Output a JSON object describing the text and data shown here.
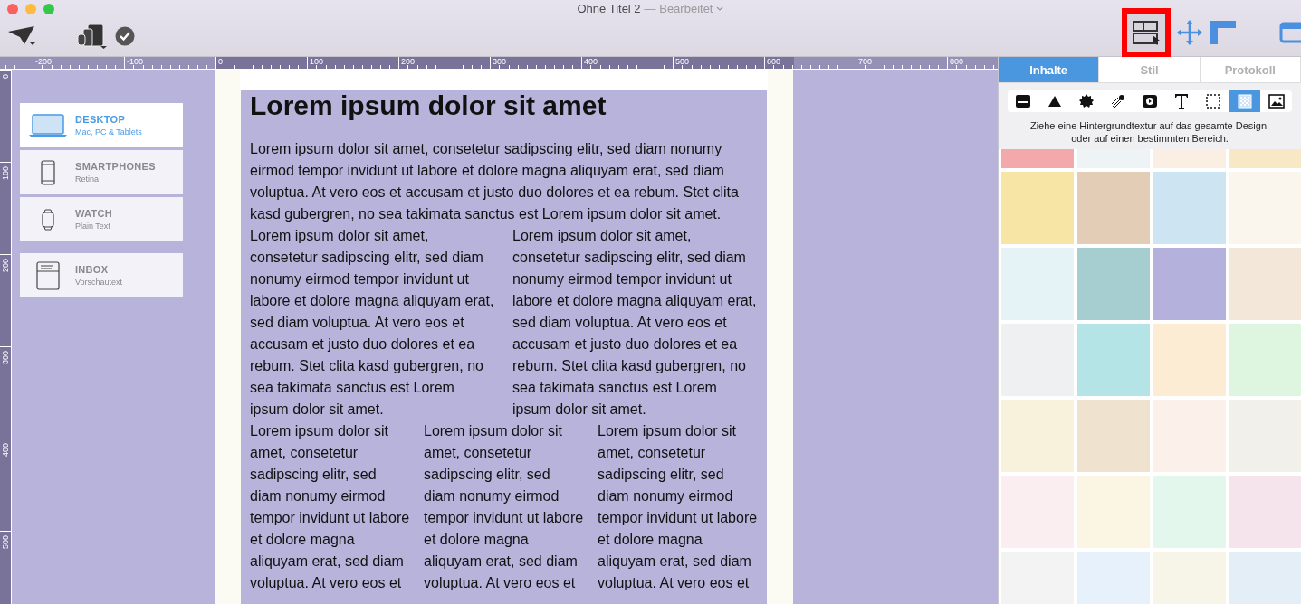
{
  "window": {
    "title": "Ohne Titel 2",
    "status": "— Bearbeitet"
  },
  "ruler": {
    "horizontal": [
      "-200",
      "-100",
      "0",
      "100",
      "200",
      "300",
      "400",
      "500",
      "600",
      "700",
      "800"
    ],
    "vertical": [
      "0",
      "100",
      "200",
      "300",
      "400",
      "500"
    ]
  },
  "devices": [
    {
      "kind": "desktop",
      "name": "DESKTOP",
      "sub": "Mac, PC & Tablets",
      "selected": true
    },
    {
      "kind": "phone",
      "name": "SMARTPHONES",
      "sub": "Retina",
      "selected": false
    },
    {
      "kind": "watch",
      "name": "WATCH",
      "sub": "Plain Text",
      "selected": false
    },
    {
      "kind": "inbox",
      "name": "INBOX",
      "sub": "Vorschautext",
      "selected": false
    }
  ],
  "document": {
    "title": "Lorem ipsum dolor sit amet",
    "intro": "Lorem ipsum dolor sit amet, consetetur sadipscing elitr, sed diam nonumy eirmod tempor invidunt ut labore et dolore magna aliquyam erat, sed diam voluptua. At vero eos et accusam et justo duo dolores et ea rebum. Stet clita kasd gubergren, no sea takimata sanctus est Lorem ipsum dolor sit amet.",
    "two_columns": [
      "Lorem ipsum dolor sit amet, consetetur sadipscing elitr, sed diam nonumy eirmod tempor invidunt ut labore et dolore magna aliquyam erat, sed diam voluptua. At vero eos et accusam et justo duo dolores et ea rebum. Stet clita kasd gubergren, no sea takimata sanctus est Lorem ipsum dolor sit amet.",
      "Lorem ipsum dolor sit amet, consetetur sadipscing elitr, sed diam nonumy eirmod tempor invidunt ut labore et dolore magna aliquyam erat, sed diam voluptua. At vero eos et accusam et justo duo dolores et ea rebum. Stet clita kasd gubergren, no sea takimata sanctus est Lorem ipsum dolor sit amet."
    ],
    "three_columns": [
      "Lorem ipsum dolor sit amet, consetetur sadipscing elitr, sed diam nonumy eirmod tempor invidunt ut labore et dolore magna aliquyam erat, sed diam voluptua. At vero eos et",
      "Lorem ipsum dolor sit amet, consetetur sadipscing elitr, sed diam nonumy eirmod tempor invidunt ut labore et dolore magna aliquyam erat, sed diam voluptua. At vero eos et",
      "Lorem ipsum dolor sit amet, consetetur sadipscing elitr, sed diam nonumy eirmod tempor invidunt ut labore et dolore magna aliquyam erat, sed diam voluptua. At vero eos et"
    ]
  },
  "panel": {
    "tabs": [
      {
        "label": "Inhalte",
        "selected": true
      },
      {
        "label": "Stil",
        "selected": false
      },
      {
        "label": "Protokoll",
        "selected": false
      }
    ],
    "tools": [
      {
        "kind": "block",
        "selected": false
      },
      {
        "kind": "triangle",
        "selected": false
      },
      {
        "kind": "star",
        "selected": false
      },
      {
        "kind": "comet",
        "selected": false
      },
      {
        "kind": "video",
        "selected": false
      },
      {
        "kind": "text",
        "selected": false
      },
      {
        "kind": "frame",
        "selected": false
      },
      {
        "kind": "texture",
        "selected": true
      },
      {
        "kind": "image",
        "selected": false
      }
    ],
    "hint": "Ziehe eine Hintergrundtextur auf das gesamte Design, oder auf einen bestimmten Bereich.",
    "textures": [
      {
        "color": "#f3a9ab"
      },
      {
        "color": "#eef3f5"
      },
      {
        "color": "#fbeee3"
      },
      {
        "color": "#f8e8c6"
      },
      {
        "color": "#f7e5a6"
      },
      {
        "color": "#e4cdb6"
      },
      {
        "color": "#cde5f3"
      },
      {
        "color": "#faf6ee"
      },
      {
        "color": "#e6f3f6"
      },
      {
        "color": "#a6cdd0"
      },
      {
        "color": "#b5b1dd"
      },
      {
        "color": "#f3e7da"
      },
      {
        "color": "#eef0f2"
      },
      {
        "color": "#b4e4e6"
      },
      {
        "color": "#fbecd3"
      },
      {
        "color": "#def5e0"
      },
      {
        "color": "#f8f2dc"
      },
      {
        "color": "#efe3d0"
      },
      {
        "color": "#fbf0ea"
      },
      {
        "color": "#f2f0ea"
      },
      {
        "color": "#faeef0"
      },
      {
        "color": "#fbf6e4"
      },
      {
        "color": "#e4f7ec"
      },
      {
        "color": "#f5e4ec"
      },
      {
        "color": "#f3f3f3"
      },
      {
        "color": "#e6f1fb"
      },
      {
        "color": "#f7f5e8"
      },
      {
        "color": "#e3eef7"
      }
    ]
  }
}
